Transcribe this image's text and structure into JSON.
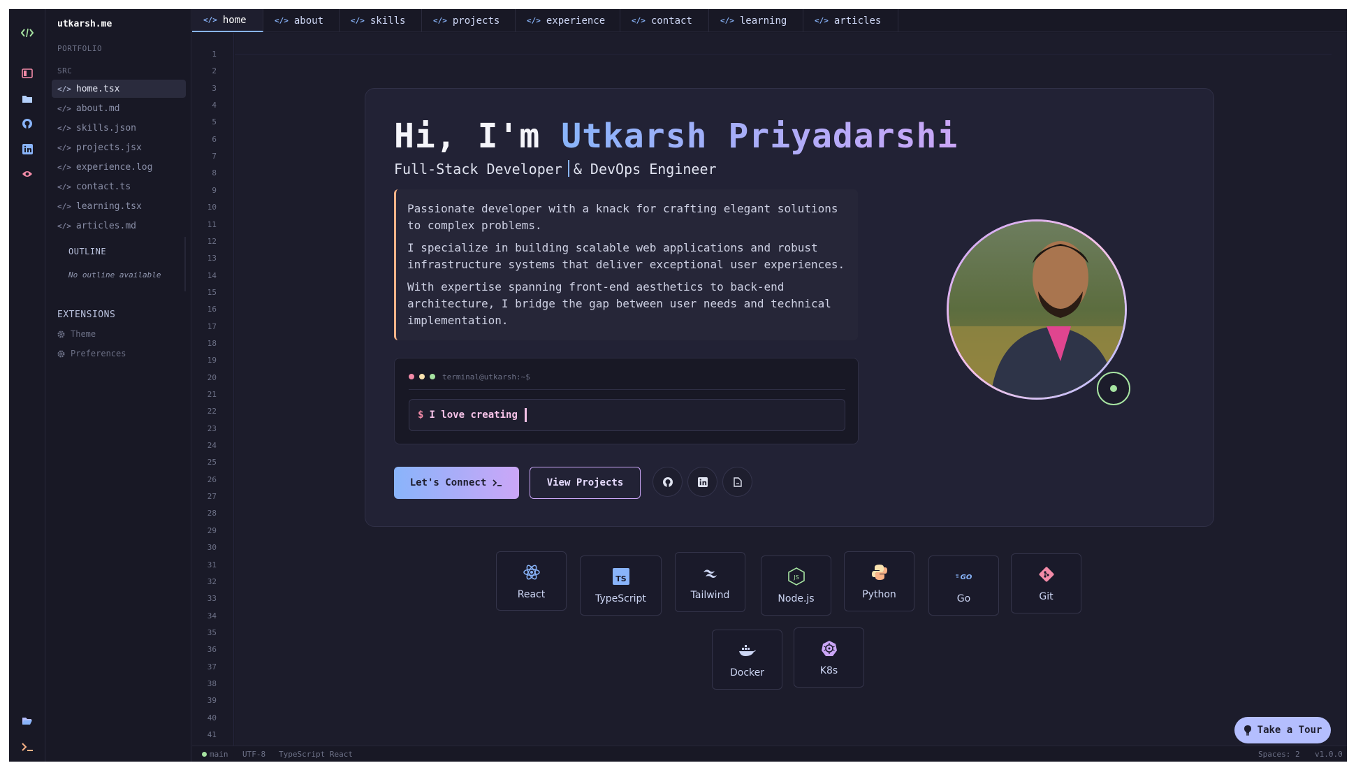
{
  "sidebar": {
    "brand": "utkarsh.me",
    "portfolio_label": "PORTFOLIO",
    "src_label": "SRC",
    "files": [
      {
        "label": "home.tsx"
      },
      {
        "label": "about.md"
      },
      {
        "label": "skills.json"
      },
      {
        "label": "projects.jsx"
      },
      {
        "label": "experience.log"
      },
      {
        "label": "contact.ts"
      },
      {
        "label": "learning.tsx"
      },
      {
        "label": "articles.md"
      }
    ],
    "outline_title": "OUTLINE",
    "outline_empty": "No outline available",
    "extensions_title": "EXTENSIONS",
    "extensions": [
      {
        "label": "Theme"
      },
      {
        "label": "Preferences"
      }
    ]
  },
  "tabs": [
    {
      "label": "home"
    },
    {
      "label": "about"
    },
    {
      "label": "skills"
    },
    {
      "label": "projects"
    },
    {
      "label": "experience"
    },
    {
      "label": "contact"
    },
    {
      "label": "learning"
    },
    {
      "label": "articles"
    }
  ],
  "line_numbers": [
    "1",
    "2",
    "3",
    "4",
    "5",
    "6",
    "7",
    "8",
    "9",
    "10",
    "11",
    "12",
    "13",
    "14",
    "15",
    "16",
    "17",
    "18",
    "19",
    "20",
    "21",
    "22",
    "23",
    "24",
    "25",
    "26",
    "27",
    "28",
    "29",
    "30",
    "31",
    "32",
    "33",
    "34",
    "35",
    "36",
    "37",
    "38",
    "39",
    "40",
    "41"
  ],
  "hero": {
    "greeting": "Hi, I'm",
    "name": "Utkarsh Priyadarshi",
    "role_a": "Full-Stack Developer",
    "role_b": "& DevOps Engineer",
    "paragraphs": [
      "Passionate developer with a knack for crafting elegant solutions to complex problems.",
      "I specialize in building scalable web applications and robust infrastructure systems that deliver exceptional user experiences.",
      "With expertise spanning front-end aesthetics to back-end architecture, I bridge the gap between user needs and technical implementation."
    ],
    "terminal_label": "terminal@utkarsh:~$",
    "terminal_prompt": "$",
    "terminal_text": "I love creating",
    "connect_label": "Let's Connect",
    "projects_label": "View Projects"
  },
  "tech": [
    {
      "label": "React",
      "icon": "react-icon"
    },
    {
      "label": "TypeScript",
      "icon": "typescript-icon"
    },
    {
      "label": "Tailwind",
      "icon": "tailwind-icon"
    },
    {
      "label": "Node.js",
      "icon": "nodejs-icon"
    },
    {
      "label": "Python",
      "icon": "python-icon"
    },
    {
      "label": "Go",
      "icon": "go-icon"
    },
    {
      "label": "Git",
      "icon": "git-icon"
    },
    {
      "label": "Docker",
      "icon": "docker-icon"
    },
    {
      "label": "K8s",
      "icon": "kubernetes-icon"
    }
  ],
  "statusbar": {
    "branch": "main",
    "encoding": "UTF-8",
    "language": "TypeScript React",
    "spaces": "Spaces: 2",
    "version": "v1.0.0"
  },
  "tour_label": "Take a Tour",
  "colors": {
    "accent_blue": "#89b4fa",
    "accent_purple": "#cba6f7",
    "accent_peach": "#fab387",
    "status_green": "#a6e3a1",
    "background": "#1a1a28"
  }
}
